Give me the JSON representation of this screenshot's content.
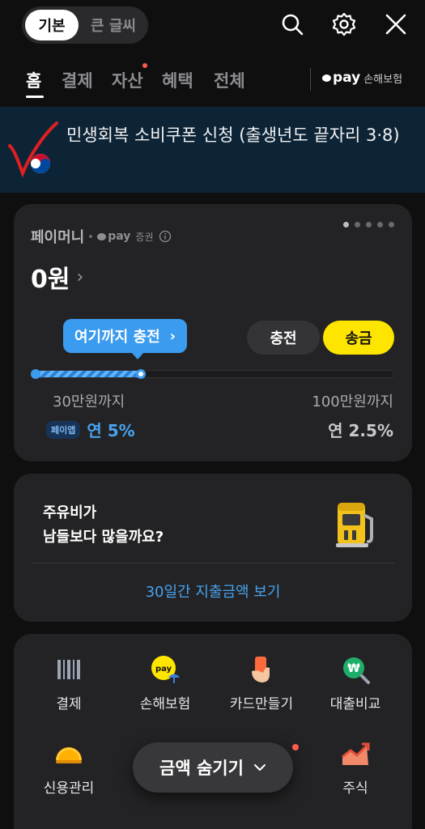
{
  "top_bar": {
    "font_toggle": {
      "options": [
        "기본",
        "큰 글씨"
      ],
      "selected": "기본"
    },
    "icons": [
      "search-icon",
      "gear-icon",
      "close-icon"
    ]
  },
  "tabs": {
    "items": [
      "홈",
      "결제",
      "자산",
      "혜택",
      "전체"
    ],
    "active": "홈",
    "insurance_brand": "pay",
    "insurance_label": "손해보험"
  },
  "banner": {
    "text": "민생회복 소비쿠폰 신청 (출생년도 끝자리 3·8)"
  },
  "paymoney": {
    "label": "페이머니",
    "partner": "pay",
    "partner_sub": "증권",
    "balance": "0원",
    "charge_tip": "여기까지 충전",
    "charge_label": "충전",
    "send_label": "송금",
    "progress_fraction": 0.3,
    "limit_left": "30만원까지",
    "limit_right": "100만원까지",
    "badge": "페이앱",
    "rate_left": "연 5%",
    "rate_right": "연 2.5%",
    "page_count": 5,
    "page_active": 1
  },
  "fuel": {
    "line1": "주유비가",
    "line2": "남들보다 많을까요?",
    "link": "30일간 지출금액 보기"
  },
  "menu": {
    "items": [
      {
        "label": "결제",
        "icon": "barcode-icon"
      },
      {
        "label": "손해보험",
        "icon": "pay-umbrella-icon"
      },
      {
        "label": "카드만들기",
        "icon": "card-hand-icon"
      },
      {
        "label": "대출비교",
        "icon": "loan-search-icon"
      },
      {
        "label": "신용관리",
        "icon": "credit-gauge-icon"
      },
      {
        "label": "주식",
        "icon": "stock-chart-icon"
      }
    ]
  },
  "floating": {
    "hide_amount_label": "금액 숨기기"
  },
  "colors": {
    "background": "#0f0f10",
    "card": "#232325",
    "accent_blue": "#3b9bef",
    "accent_yellow": "#fee500",
    "banner": "#0d2437",
    "notification": "#ff5a4e"
  }
}
